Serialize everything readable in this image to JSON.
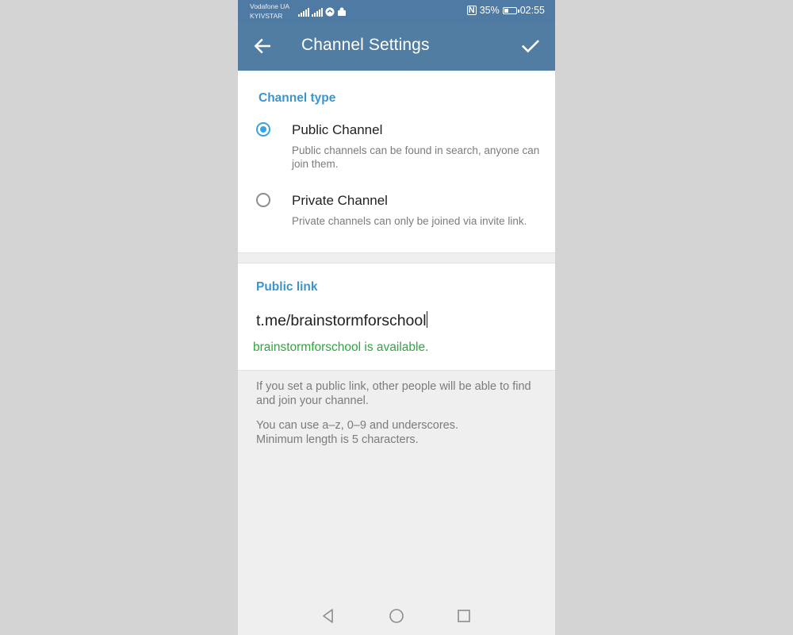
{
  "status_bar": {
    "carrier_1": "Vodafone UA",
    "carrier_2": "KYIVSTAR",
    "battery_percent_text": "35%",
    "battery_level": 0.35,
    "time": "02:55",
    "nfc_label": "N"
  },
  "app_bar": {
    "title": "Channel Settings",
    "back_icon": "arrow-left-icon",
    "confirm_icon": "check-icon"
  },
  "channel_type": {
    "heading": "Channel type",
    "options": [
      {
        "title": "Public Channel",
        "description": "Public channels can be found in search, anyone can join them.",
        "selected": true
      },
      {
        "title": "Private Channel",
        "description": "Private channels can only be joined via invite link.",
        "selected": false
      }
    ]
  },
  "public_link": {
    "heading": "Public link",
    "prefix": "t.me/",
    "value": "brainstormforschool",
    "availability": "brainstormforschool is available."
  },
  "info": {
    "paragraph_1": "If you set a public link, other people will be able to find and join your channel.",
    "paragraph_2_line_1": "You can use a–z, 0–9 and underscores.",
    "paragraph_2_line_2": "Minimum length is 5 characters."
  },
  "colors": {
    "app_bar": "#517da2",
    "accent": "#3a95cf",
    "available_text": "#33a442",
    "page_background": "#efefef"
  }
}
